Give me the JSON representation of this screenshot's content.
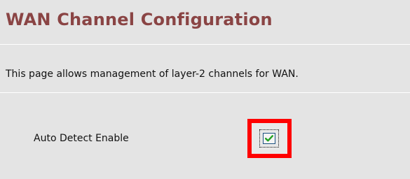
{
  "page": {
    "title": "WAN Channel Configuration",
    "description": "This page allows management of layer-2 channels for WAN."
  },
  "auto_detect": {
    "label": "Auto Detect Enable",
    "checked": true,
    "check_icon": "check-icon"
  },
  "colors": {
    "title": "#8a4444",
    "background": "#e4e4e4",
    "highlight_border": "#ff0000",
    "checkmark": "#21a121",
    "checkbox_border": "#1c5180"
  }
}
